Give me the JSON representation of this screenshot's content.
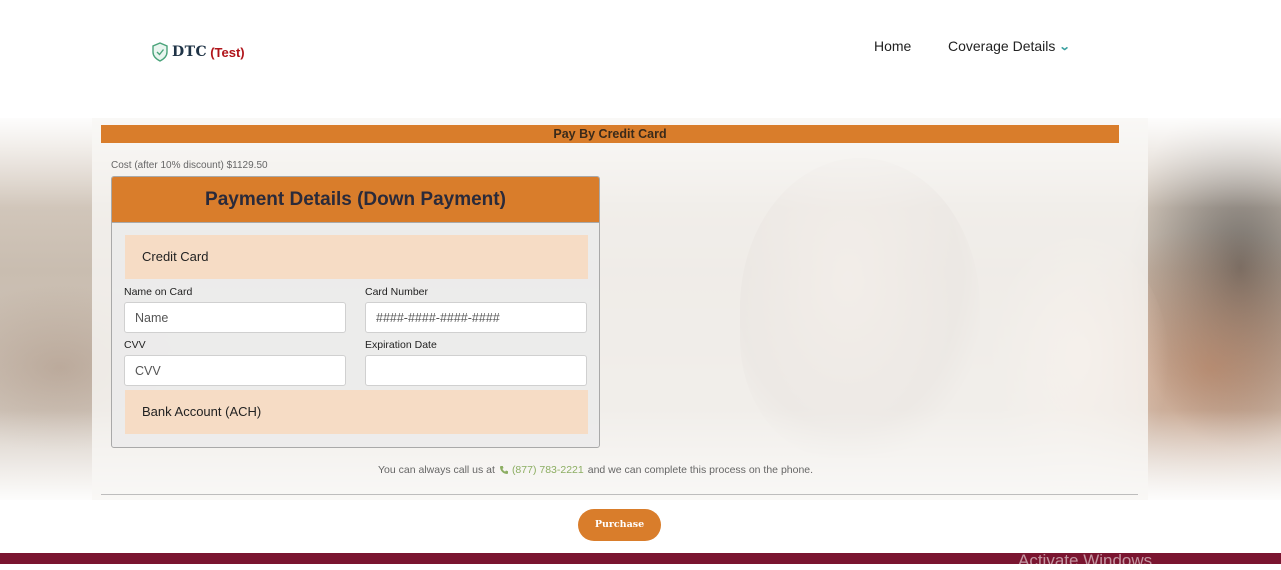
{
  "header": {
    "logo_text": "DTC",
    "logo_badge": "(Test)",
    "nav": {
      "home": "Home",
      "coverage": "Coverage Details"
    }
  },
  "page_title": "Pay By Credit Card",
  "cost_text": "Cost (after 10% discount) $1129.50",
  "payment": {
    "heading": "Payment Details (Down Payment)",
    "credit_card_section": "Credit Card",
    "name_label": "Name on Card",
    "name_placeholder": "Name",
    "card_number_label": "Card Number",
    "card_number_placeholder": "####-####-####-####",
    "cvv_label": "CVV",
    "cvv_placeholder": "CVV",
    "expiration_label": "Expiration Date",
    "expiration_value": "",
    "bank_section": "Bank Account (ACH)"
  },
  "call": {
    "prefix": "You can always call us at",
    "phone": "(877) 783-2221",
    "suffix": "and we can complete this process on the phone."
  },
  "purchase_label": "Purchase",
  "watermark": "Activate Windows",
  "colors": {
    "accent": "#d97d2b",
    "section_bg": "#f6dcc5",
    "footer": "#7a1530",
    "phone": "#8cae62"
  }
}
